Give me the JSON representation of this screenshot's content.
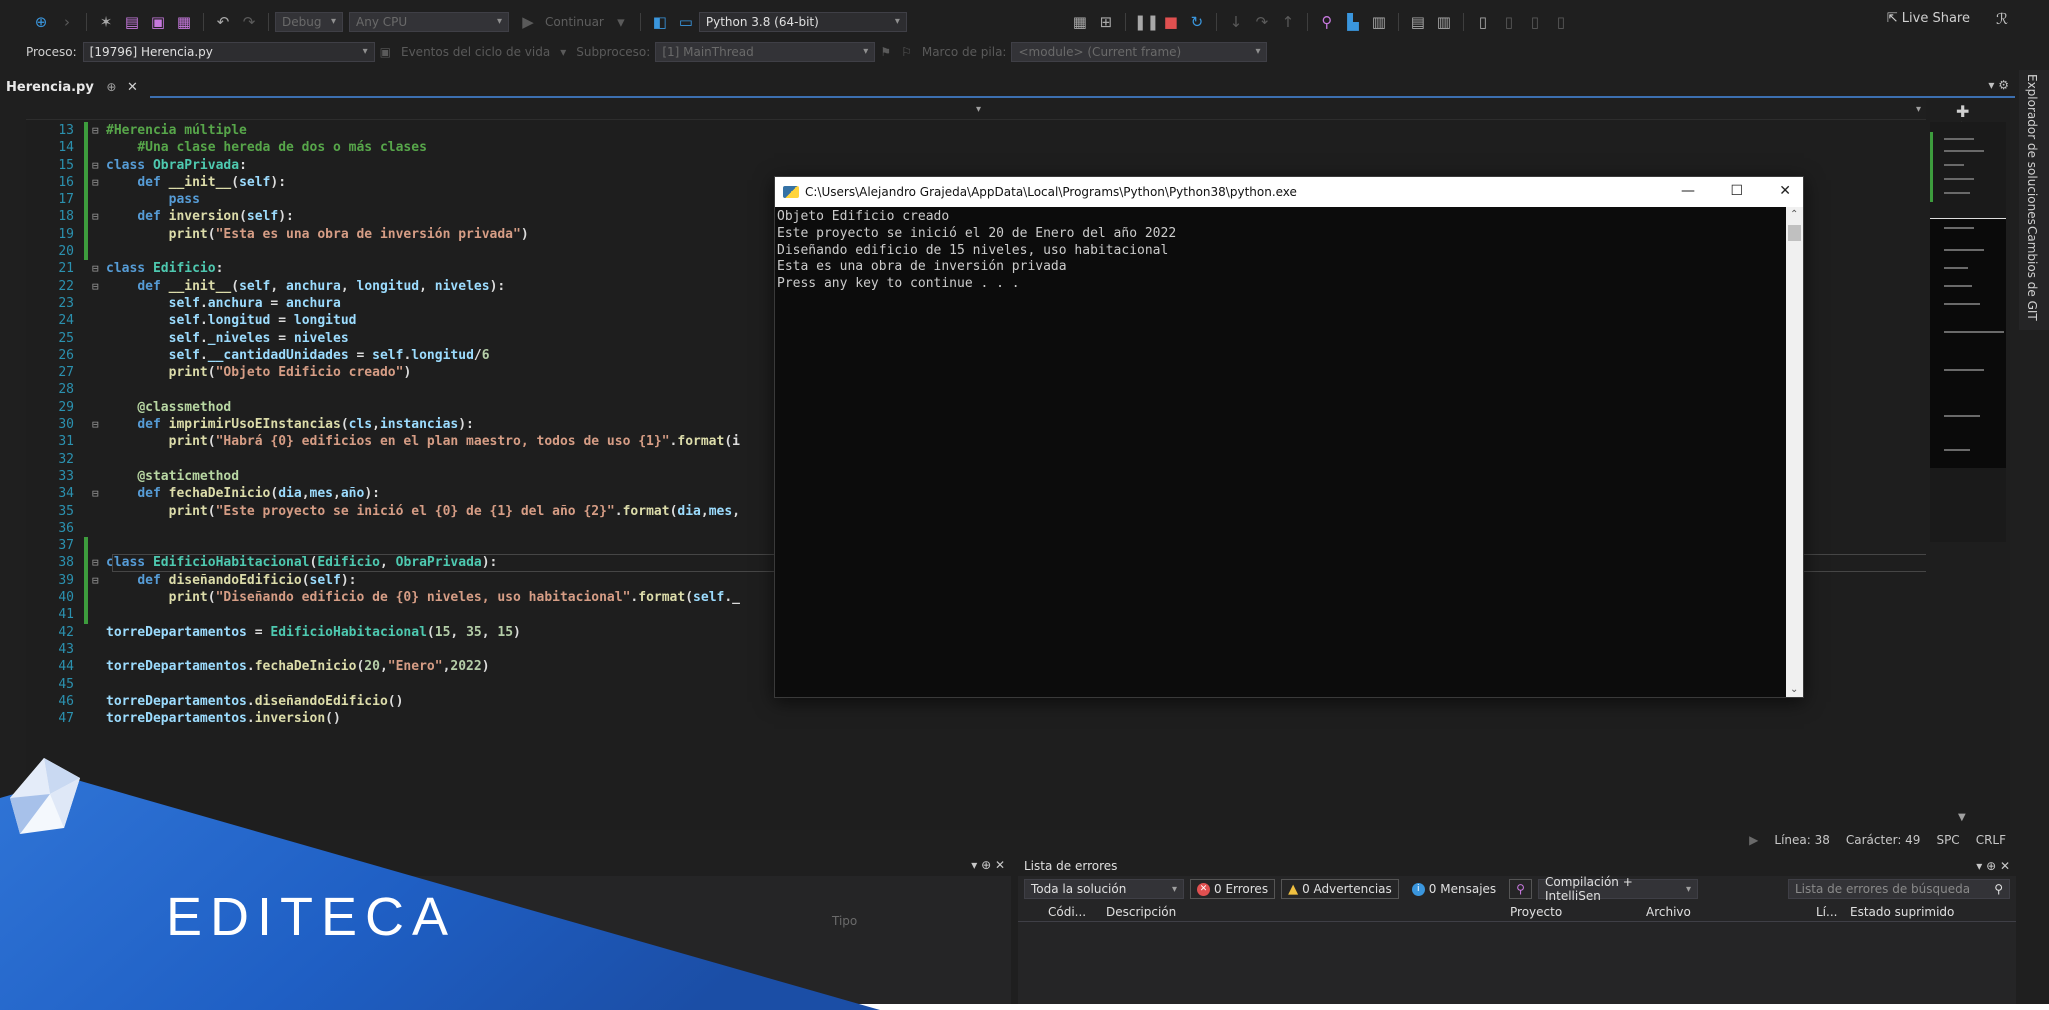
{
  "toolbar": {
    "config": "Debug",
    "platform": "Any CPU",
    "continue": "Continuar",
    "python_env": "Python 3.8 (64-bit)",
    "live_share": "Live Share"
  },
  "toolbar2": {
    "process_label": "Proceso:",
    "process_value": "[19796] Herencia.py",
    "lifecycle": "Eventos del ciclo de vida",
    "thread_label": "Subproceso:",
    "thread_value": "[1] MainThread",
    "stack_label": "Marco de pila:",
    "stack_value": "<module> (Current frame)"
  },
  "side_tabs": [
    "Explorador de soluciones",
    "Cambios de GIT"
  ],
  "document_tab": {
    "name": "Herencia.py",
    "pin": "⊕",
    "close": "✕"
  },
  "code": [
    {
      "n": "13",
      "fold": "⊟",
      "g": 1,
      "html": "<span class='c'>#Herencia múltiple</span>"
    },
    {
      "n": "14",
      "fold": "",
      "g": 1,
      "html": "    <span class='c'>#Una clase hereda de dos o más clases</span>"
    },
    {
      "n": "15",
      "fold": "⊟",
      "g": 1,
      "html": "<span class='k'>class</span> <span class='t'>ObraPrivada</span>:"
    },
    {
      "n": "16",
      "fold": "⊟",
      "g": 1,
      "html": "    <span class='k'>def</span> <span class='f'>__init__</span>(<span class='v'>self</span>):"
    },
    {
      "n": "17",
      "fold": "",
      "g": 1,
      "html": "        <span class='k'>pass</span>"
    },
    {
      "n": "18",
      "fold": "⊟",
      "g": 1,
      "html": "    <span class='k'>def</span> <span class='f'>inversion</span>(<span class='v'>self</span>):"
    },
    {
      "n": "19",
      "fold": "",
      "g": 1,
      "html": "        <span class='f'>print</span>(<span class='s'>\"Esta es una obra de inversión privada\"</span>)"
    },
    {
      "n": "20",
      "fold": "",
      "g": 1,
      "html": ""
    },
    {
      "n": "21",
      "fold": "⊟",
      "g": 0,
      "html": "<span class='k'>class</span> <span class='t'>Edificio</span>:"
    },
    {
      "n": "22",
      "fold": "⊟",
      "g": 0,
      "html": "    <span class='k'>def</span> <span class='f'>__init__</span>(<span class='v'>self</span>, <span class='v'>anchura</span>, <span class='v'>longitud</span>, <span class='v'>niveles</span>):"
    },
    {
      "n": "23",
      "fold": "",
      "g": 0,
      "html": "        <span class='v'>self</span>.<span class='v'>anchura</span> = <span class='v'>anchura</span>"
    },
    {
      "n": "24",
      "fold": "",
      "g": 0,
      "html": "        <span class='v'>self</span>.<span class='v'>longitud</span> = <span class='v'>longitud</span>"
    },
    {
      "n": "25",
      "fold": "",
      "g": 0,
      "html": "        <span class='v'>self</span>.<span class='v'>_niveles</span> = <span class='v'>niveles</span>"
    },
    {
      "n": "26",
      "fold": "",
      "g": 0,
      "html": "        <span class='v'>self</span>.<span class='v'>__cantidadUnidades</span> = <span class='v'>self</span>.<span class='v'>longitud</span>/<span class='n'>6</span>"
    },
    {
      "n": "27",
      "fold": "",
      "g": 0,
      "html": "        <span class='f'>print</span>(<span class='s'>\"Objeto Edificio creado\"</span>)"
    },
    {
      "n": "28",
      "fold": "",
      "g": 0,
      "html": ""
    },
    {
      "n": "29",
      "fold": "",
      "g": 0,
      "html": "    <span class='d'>@classmethod</span>"
    },
    {
      "n": "30",
      "fold": "⊟",
      "g": 0,
      "html": "    <span class='k'>def</span> <span class='f'>imprimirUsoEInstancias</span>(<span class='v'>cls</span>,<span class='v'>instancias</span>):"
    },
    {
      "n": "31",
      "fold": "",
      "g": 0,
      "html": "        <span class='f'>print</span>(<span class='s'>\"Habrá {0} edificios en el plan maestro, todos de uso {1}\"</span>.<span class='f'>format</span>(i"
    },
    {
      "n": "32",
      "fold": "",
      "g": 0,
      "html": ""
    },
    {
      "n": "33",
      "fold": "",
      "g": 0,
      "html": "    <span class='d'>@staticmethod</span>"
    },
    {
      "n": "34",
      "fold": "⊟",
      "g": 0,
      "html": "    <span class='k'>def</span> <span class='f'>fechaDeInicio</span>(<span class='v'>dia</span>,<span class='v'>mes</span>,<span class='v'>año</span>):"
    },
    {
      "n": "35",
      "fold": "",
      "g": 0,
      "html": "        <span class='f'>print</span>(<span class='s'>\"Este proyecto se inició el {0} de {1} del año {2}\"</span>.<span class='f'>format</span>(<span class='v'>dia</span>,<span class='v'>mes</span>,"
    },
    {
      "n": "36",
      "fold": "",
      "g": 0,
      "html": ""
    },
    {
      "n": "37",
      "fold": "",
      "g": 1,
      "html": ""
    },
    {
      "n": "38",
      "fold": "⊟",
      "g": 1,
      "cur": 1,
      "html": "<span class='k'>class</span> <span class='t'>EdificioHabitacional</span>(<span class='t'>Edificio</span>, <span class='t'>ObraPrivada</span>):"
    },
    {
      "n": "39",
      "fold": "⊟",
      "g": 1,
      "html": "    <span class='k'>def</span> <span class='f'>diseñandoEdificio</span>(<span class='v'>self</span>):"
    },
    {
      "n": "40",
      "fold": "",
      "g": 1,
      "html": "        <span class='f'>print</span>(<span class='s'>\"Diseñando edificio de {0} niveles, uso habitacional\"</span>.<span class='f'>format</span>(<span class='v'>self</span>._"
    },
    {
      "n": "41",
      "fold": "",
      "g": 1,
      "html": ""
    },
    {
      "n": "42",
      "fold": "",
      "g": 0,
      "html": "<span class='v'>torreDepartamentos</span> = <span class='t'>EdificioHabitacional</span>(<span class='n'>15</span>, <span class='n'>35</span>, <span class='n'>15</span>)"
    },
    {
      "n": "43",
      "fold": "",
      "g": 0,
      "html": ""
    },
    {
      "n": "44",
      "fold": "",
      "g": 0,
      "html": "<span class='v'>torreDepartamentos</span>.<span class='f'>fechaDeInicio</span>(<span class='n'>20</span>,<span class='s'>\"Enero\"</span>,<span class='n'>2022</span>)"
    },
    {
      "n": "45",
      "fold": "",
      "g": 0,
      "html": ""
    },
    {
      "n": "46",
      "fold": "",
      "g": 0,
      "html": "<span class='v'>torreDepartamentos</span>.<span class='f'>diseñandoEdificio</span>()"
    },
    {
      "n": "47",
      "fold": "",
      "g": 0,
      "html": "<span class='v'>torreDepartamentos</span>.<span class='f'>inversion</span>()"
    }
  ],
  "status": {
    "line": "Línea: 38",
    "char": "Carácter: 49",
    "spc": "SPC",
    "crlf": "CRLF"
  },
  "left_panel": {
    "col_tipo": "Tipo"
  },
  "error_list": {
    "title": "Lista de errores",
    "scope": "Toda la solución",
    "errors": "0 Errores",
    "warnings": "0 Advertencias",
    "messages": "0 Mensajes",
    "build_filter": "Compilación + IntelliSen",
    "search_placeholder": "Lista de errores de búsqueda",
    "columns": [
      "Códi...",
      "Descripción",
      "Proyecto",
      "Archivo",
      "Lí...",
      "Estado suprimido"
    ]
  },
  "console": {
    "title": "C:\\Users\\Alejandro Grajeda\\AppData\\Local\\Programs\\Python\\Python38\\python.exe",
    "lines": [
      "Objeto Edificio creado",
      "Este proyecto se inició el 20 de Enero del año 2022",
      "Diseñando edificio de 15 niveles, uso habitacional",
      "Esta es una obra de inversión privada",
      "Press any key to continue . . ."
    ]
  },
  "brand": {
    "name": "EDITECA"
  },
  "colors": {
    "accent": "#2b6fd8",
    "editor_bg": "#1e1e1e",
    "changed_gutter": "#3d9c3d"
  }
}
